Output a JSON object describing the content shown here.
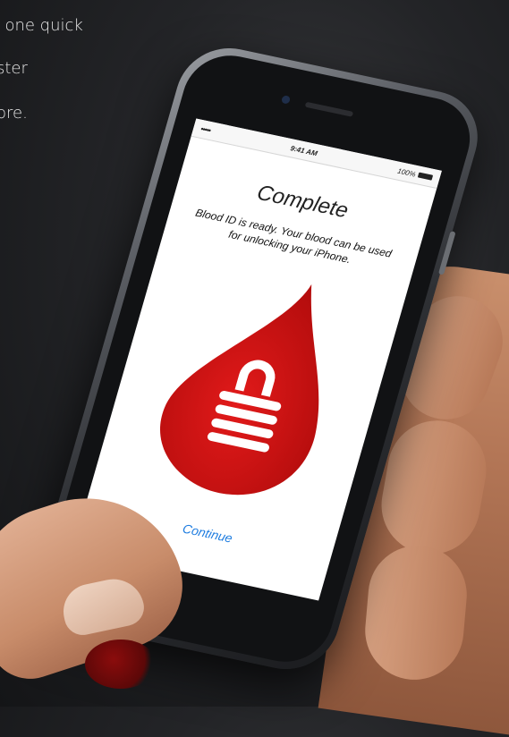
{
  "background_text": {
    "line1": ", one quick",
    "line2": "ster",
    "line3": "ore."
  },
  "status_bar": {
    "signal": "•••••",
    "time": "9:41 AM",
    "battery": "100%"
  },
  "screen": {
    "title": "Complete",
    "description_line1": "Blood ID is ready. Your blood can be used",
    "description_line2": "for unlocking your iPhone.",
    "continue_label": "Continue"
  },
  "colors": {
    "drop_red": "#d11414",
    "link_blue": "#1f7de0"
  },
  "icons": {
    "drop": "blood-drop-icon",
    "lock": "lock-icon"
  }
}
